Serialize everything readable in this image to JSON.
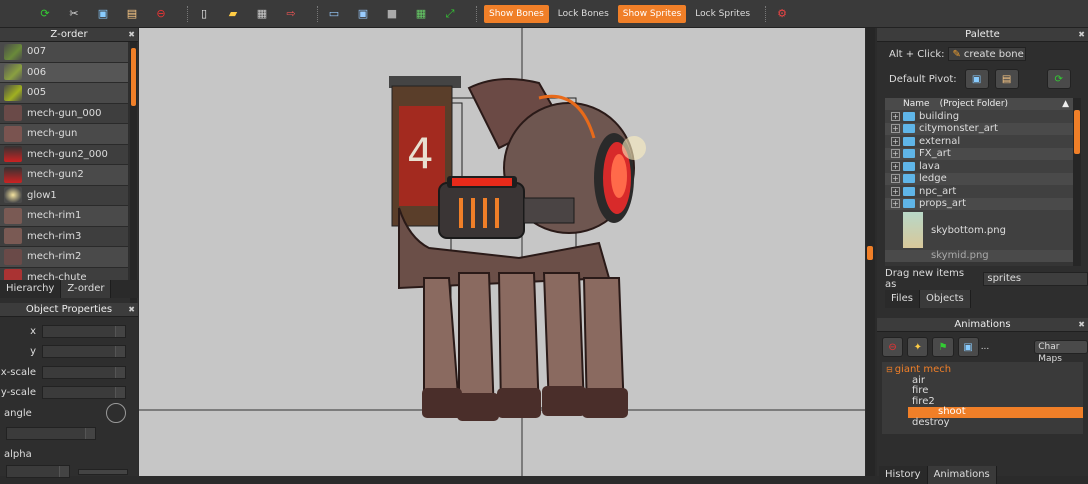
{
  "toolbar": {
    "icons": [
      "refresh-icon",
      "scissors-icon",
      "copy-icon",
      "paste-icon",
      "delete-icon",
      "new-file-icon",
      "open-folder-icon",
      "save-icon",
      "export-icon",
      "window-icon",
      "monitor-icon",
      "stop-icon",
      "calendar-icon",
      "fullscreen-icon"
    ],
    "show_bones": "Show Bones",
    "lock_bones": "Lock Bones",
    "show_sprites": "Show Sprites",
    "lock_sprites": "Lock Sprites"
  },
  "zorder": {
    "title": "Z-order",
    "items": [
      "007",
      "006",
      "005",
      "mech-gun_000",
      "mech-gun",
      "mech-gun2_000",
      "mech-gun2",
      "glow1",
      "mech-rim1",
      "mech-rim3",
      "mech-rim2",
      "mech-chute"
    ],
    "tabs": [
      "Hierarchy",
      "Z-order"
    ]
  },
  "props": {
    "title": "Object Properties",
    "fields": [
      "x",
      "y",
      "x-scale",
      "y-scale"
    ],
    "angle": "angle",
    "alpha": "alpha"
  },
  "palette": {
    "title": "Palette",
    "alt_click": "Alt + Click:",
    "create_bone": "create bone",
    "default_pivot": "Default Pivot:",
    "col_name": "Name",
    "col_folder": "(Project Folder)",
    "folders": [
      "building",
      "citymonster_art",
      "external",
      "FX_art",
      "lava",
      "ledge",
      "npc_art",
      "props_art"
    ],
    "image_file": "skybottom.png",
    "image_file2": "skymid.png",
    "drag_label": "Drag new items as",
    "drag_value": "sprites",
    "tabs": [
      "Files",
      "Objects"
    ]
  },
  "animations": {
    "title": "Animations",
    "char_maps": "Char Maps",
    "root": "giant mech",
    "items": [
      "air",
      "fire",
      "fire2",
      "shoot",
      "destroy"
    ],
    "selected": "shoot",
    "tabs": [
      "History",
      "Animations"
    ]
  },
  "colors": {
    "accent": "#f07f28"
  }
}
